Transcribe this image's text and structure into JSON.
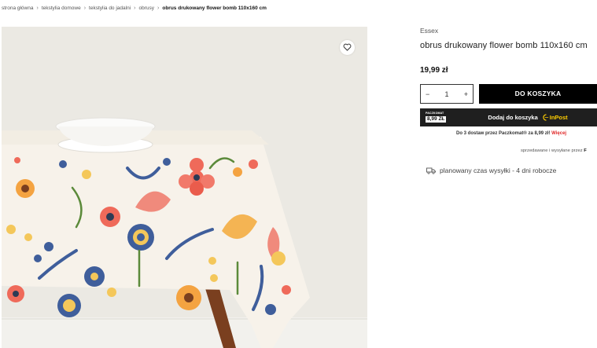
{
  "breadcrumb": {
    "items": [
      "strona główna",
      "tekstylia domowe",
      "tekstylia do jadalni",
      "obrusy"
    ],
    "current": "obrus drukowany flower bomb 110x160 cm",
    "separator": "›"
  },
  "product": {
    "brand": "Essex",
    "title": "obrus drukowany flower bomb 110x160 cm",
    "price": "19,99 zł",
    "quantity": "1",
    "qty_minus": "−",
    "qty_plus": "+",
    "add_to_cart_label": "DO KOSZYKA"
  },
  "paczkomat": {
    "badge_label": "PACZKOMAT",
    "badge_price": "8,99 ZŁ",
    "text": "Dodaj do koszyka",
    "logo_text": "InPost"
  },
  "delivery": {
    "text_before": "Do 3 dostaw przez Paczkomat® za ",
    "price": "8,99 zł!",
    "more_link": "Więcej"
  },
  "seller": {
    "text": "sprzedawane i wysyłane przez",
    "name": "F"
  },
  "shipping": {
    "text": "planowany czas wysyłki - 4 dni robocze"
  },
  "colors": {
    "accent": "#000000",
    "link_red": "#e02a2a",
    "inpost_yellow": "#ffcd00"
  },
  "icons": {
    "wishlist": "heart-icon",
    "shipping": "truck-icon",
    "breadcrumb_separator": "chevron-right-icon"
  }
}
